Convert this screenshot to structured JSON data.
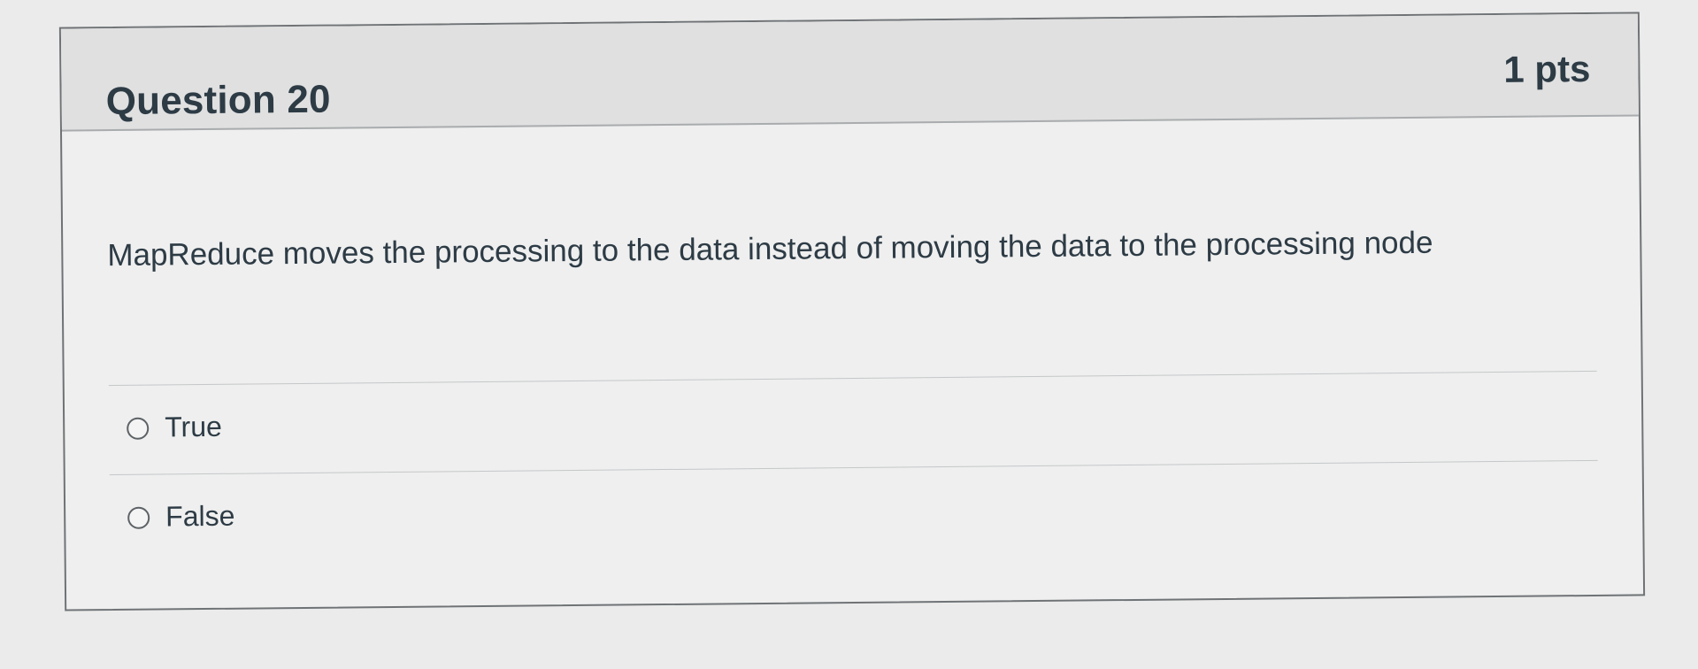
{
  "question": {
    "title": "Question 20",
    "points": "1 pts",
    "text": "MapReduce moves the processing to the data instead of moving the data to the processing node",
    "answers": [
      {
        "label": "True",
        "selected": false
      },
      {
        "label": "False",
        "selected": false
      }
    ]
  }
}
